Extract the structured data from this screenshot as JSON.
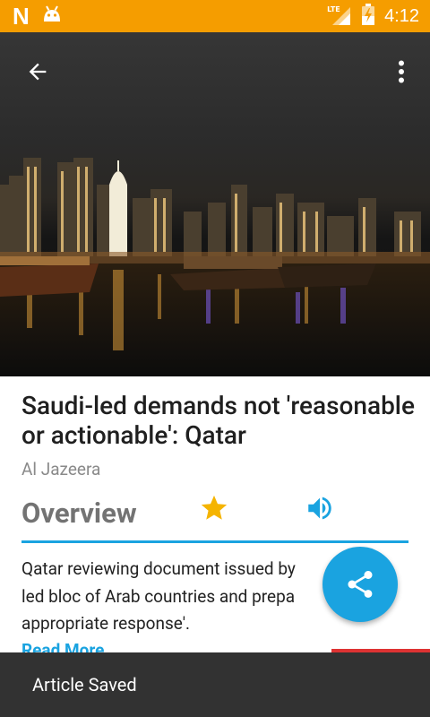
{
  "status_bar": {
    "app_letter": "N",
    "network_label": "LTE",
    "time": "4:12",
    "background_color": "#f59d00"
  },
  "toolbar": {
    "back_icon": "arrow-back-icon",
    "menu_icon": "more-vert-icon"
  },
  "article": {
    "headline": "Saudi-led demands not 'reasonable or actionable': Qatar",
    "source": "Al Jazeera",
    "section_title": "Overview",
    "summary_lines": [
      "Qatar reviewing document issued by",
      "led bloc of Arab countries and prepa",
      "appropriate response'."
    ],
    "read_more": "Read More",
    "accent_color": "#1aa3e0",
    "star_color": "#f5b400"
  },
  "fab": {
    "icon": "share-icon",
    "color": "#1aa3e0"
  },
  "snackbar": {
    "message": "Article Saved"
  }
}
